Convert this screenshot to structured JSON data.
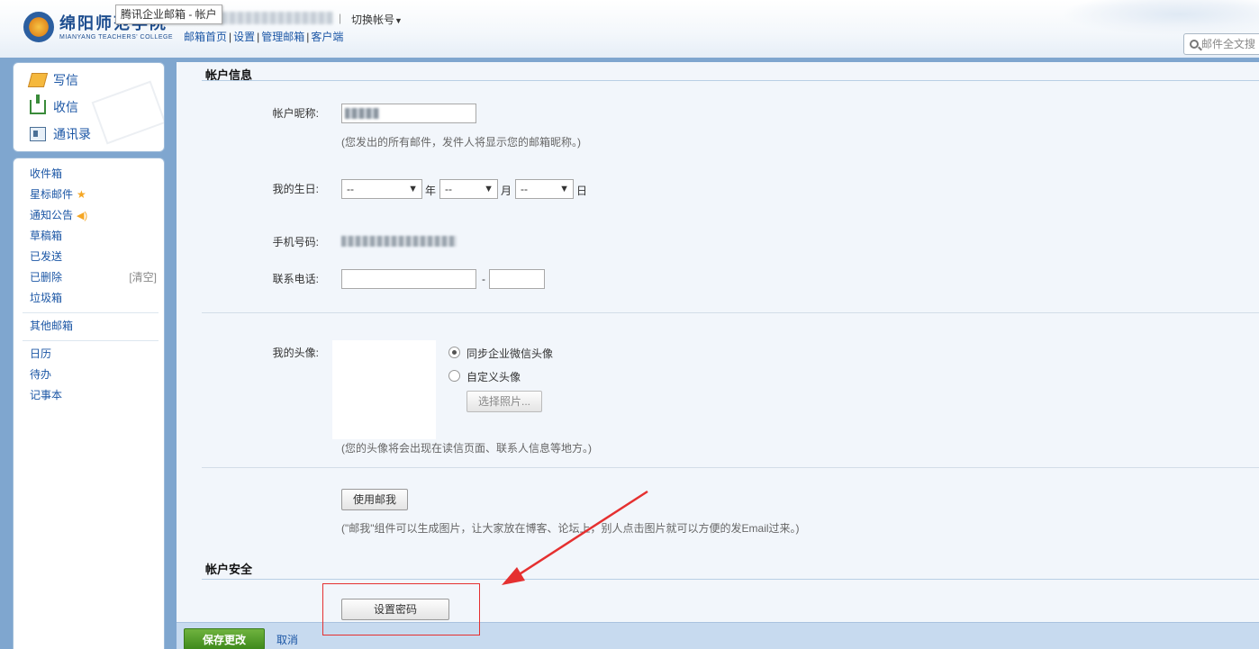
{
  "header": {
    "logo_name": "绵阳师范学院",
    "logo_en": "MIANYANG TEACHERS' COLLEGE",
    "tooltip": "腾讯企业邮箱 - 帐户",
    "separator": "|",
    "switch_account": "切换帐号",
    "links": [
      "邮箱首页",
      "设置",
      "管理邮箱",
      "客户端"
    ],
    "search_placeholder": "邮件全文搜"
  },
  "sidebar": {
    "actions": [
      {
        "label": "写信",
        "icon": "compose-icon"
      },
      {
        "label": "收信",
        "icon": "inbox-download-icon"
      },
      {
        "label": "通讯录",
        "icon": "contacts-icon"
      }
    ],
    "folders": [
      "收件箱",
      "星标邮件",
      "通知公告",
      "草稿箱",
      "已发送",
      "已删除",
      "垃圾箱"
    ],
    "clear": "[清空]",
    "other_mail": "其他邮箱",
    "tools": [
      "日历",
      "待办",
      "记事本"
    ]
  },
  "account_info": {
    "title": "帐户信息",
    "nickname_label": "帐户昵称:",
    "nickname_hint": "(您发出的所有邮件，发件人将显示您的邮箱昵称。)",
    "birthday_label": "我的生日:",
    "year_value": "--",
    "year_unit": "年",
    "month_value": "--",
    "month_unit": "月",
    "day_value": "--",
    "day_unit": "日",
    "mobile_label": "手机号码:",
    "phone_label": "联系电话:",
    "phone_dash": "-",
    "avatar_label": "我的头像:",
    "avatar_sync": "同步企业微信头像",
    "avatar_custom": "自定义头像",
    "choose_photo": "选择照片...",
    "avatar_hint": "(您的头像将会出现在读信页面、联系人信息等地方。)",
    "mailme_button": "使用邮我",
    "mailme_hint": "(\"邮我\"组件可以生成图片，让大家放在博客、论坛上，别人点击图片就可以方便的发Email过来。)"
  },
  "account_security": {
    "title": "帐户安全",
    "set_password": "设置密码"
  },
  "footer": {
    "save": "保存更改",
    "cancel": "取消"
  },
  "colors": {
    "link": "#1b56a5",
    "save_button": "#4f9a2a",
    "annotation": "#e53030"
  }
}
